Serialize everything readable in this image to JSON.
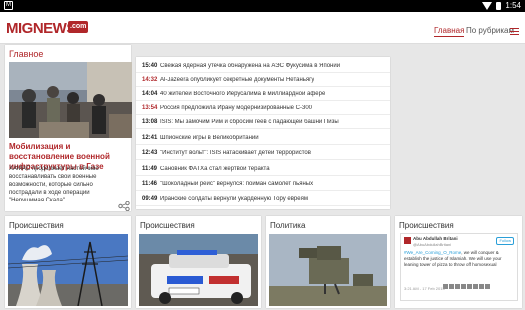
{
  "statusbar": {
    "time": "1:54",
    "notif_glyph": "M"
  },
  "appbar": {
    "logo": "MIGNEWS",
    "logo_badge": ".com",
    "nav": [
      "Главная",
      "По рубрикам"
    ]
  },
  "main_story": {
    "section": "Главное",
    "headline": "Мобилизация и восстановление военной инфраструктуры в Газе",
    "excerpt": "ХАМАС продолжает настойчиво восстанавливать свои военные возможности, которые сильно пострадали в ходе операции \"Нерушимая Скала\""
  },
  "news": [
    {
      "time": "15:40",
      "hot": false,
      "title": "Свежая ядерная утечка обнаружена на АЭС Фукусима в Японии"
    },
    {
      "time": "14:32",
      "hot": true,
      "title": "Al-Jazeera опубликует секретные документы Нетаньягу"
    },
    {
      "time": "14:04",
      "hot": false,
      "title": "40 жителей Восточного Иерусалима в миллиардной афере"
    },
    {
      "time": "13:54",
      "hot": true,
      "title": "Россия предложила Ирану модернизированные С-300"
    },
    {
      "time": "13:08",
      "hot": false,
      "title": "ISIS: Мы замочим Рим и сбросим геев с падающей башни Пизы"
    },
    {
      "time": "12:41",
      "hot": false,
      "title": "Шпионские игры в Великобритании"
    },
    {
      "time": "12:43",
      "hot": false,
      "title": "\"Институт вольт\": ISIS натаскивает детей террористов"
    },
    {
      "time": "11:49",
      "hot": false,
      "title": "Сановник ФАТХа стал жертвой теракта"
    },
    {
      "time": "11:46",
      "hot": false,
      "title": "\"Шоколадный рейс\" вернулся: пойман самолет пьяных"
    },
    {
      "time": "09:49",
      "hot": false,
      "title": "Иранские солдаты вернули укарденную Тору евреям"
    }
  ],
  "cards": [
    {
      "section": "Происшествия"
    },
    {
      "section": "Происшествия"
    },
    {
      "section": "Политика"
    },
    {
      "section": "Происшествия"
    }
  ],
  "tweet": {
    "author": "Abu Abdullah Britani",
    "handle": "@AbuAbdullahBritani",
    "follow": "Follow",
    "hashtag": "#We_Are_Coming_O_Rome",
    "text": ", we will conquer & establish the justice of Islamiah. We will use your leaning tower of pizza to throw off homosexual",
    "footer": "3:21 AM - 17 Feb 2015"
  }
}
